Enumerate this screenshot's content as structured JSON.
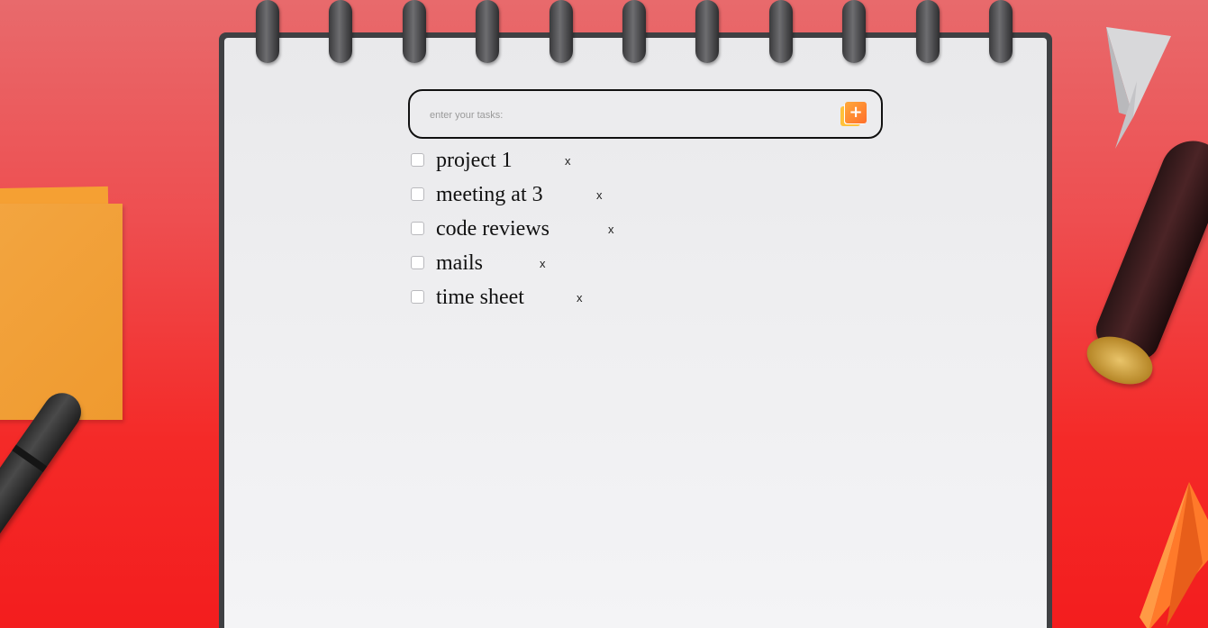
{
  "task_input": {
    "placeholder": "enter your tasks:",
    "value": ""
  },
  "add_button": {
    "icon": "add-task-icon",
    "glyph": "+"
  },
  "tasks": [
    {
      "text": "project 1",
      "checked": false,
      "delete_label": "x"
    },
    {
      "text": "meeting at 3",
      "checked": false,
      "delete_label": "x"
    },
    {
      "text": "code reviews",
      "checked": false,
      "delete_label": "x"
    },
    {
      "text": "mails",
      "checked": false,
      "delete_label": "x"
    },
    {
      "text": "time sheet",
      "checked": false,
      "delete_label": "x"
    }
  ],
  "colors": {
    "background_top": "#e86a6c",
    "background_bottom": "#f31d1e",
    "paper": "#efeff1",
    "add_button_accent": "#ff8a30",
    "input_border": "#111111"
  }
}
